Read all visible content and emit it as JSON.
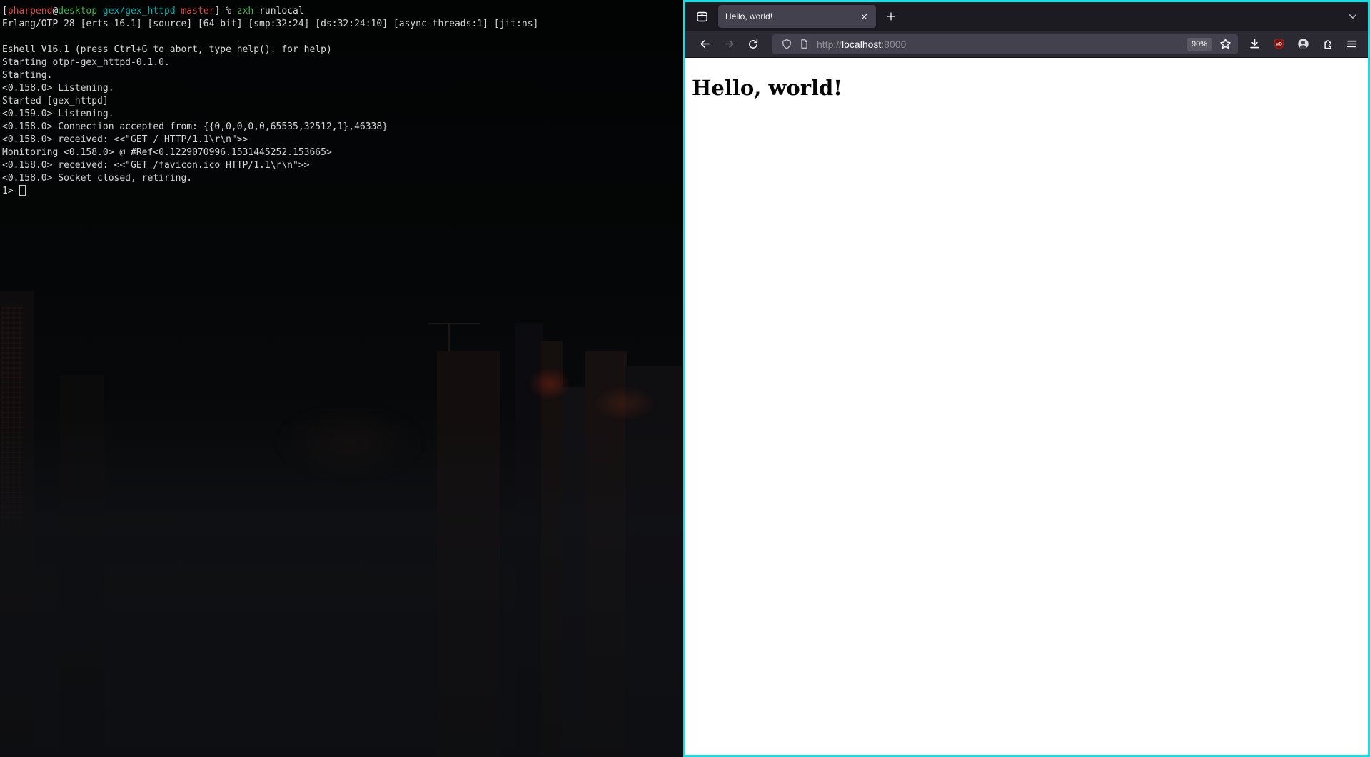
{
  "terminal": {
    "lines": [
      {
        "segments": [
          {
            "t": "[",
            "c": "fg"
          },
          {
            "t": "pharpend",
            "c": "red"
          },
          {
            "t": "@",
            "c": "fg"
          },
          {
            "t": "desktop",
            "c": "green"
          },
          {
            "t": " ",
            "c": "fg"
          },
          {
            "t": "gex/gex_httpd",
            "c": "cyan"
          },
          {
            "t": " ",
            "c": "fg"
          },
          {
            "t": "master",
            "c": "red"
          },
          {
            "t": "] % ",
            "c": "fg"
          },
          {
            "t": "zxh",
            "c": "green"
          },
          {
            "t": " runlocal",
            "c": "fg"
          }
        ]
      },
      {
        "text": "Erlang/OTP 28 [erts-16.1] [source] [64-bit] [smp:32:24] [ds:32:24:10] [async-threads:1] [jit:ns]"
      },
      {
        "text": ""
      },
      {
        "text": "Eshell V16.1 (press Ctrl+G to abort, type help(). for help)"
      },
      {
        "text": "Starting otpr-gex_httpd-0.1.0."
      },
      {
        "text": "Starting."
      },
      {
        "text": "<0.158.0> Listening."
      },
      {
        "text": "Started [gex_httpd]"
      },
      {
        "text": "<0.159.0> Listening."
      },
      {
        "text": "<0.158.0> Connection accepted from: {{0,0,0,0,0,65535,32512,1},46338}"
      },
      {
        "text": "<0.158.0> received: <<\"GET / HTTP/1.1\\r\\n\">>"
      },
      {
        "text": "Monitoring <0.158.0> @ #Ref<0.1229070996.1531445252.153665>"
      },
      {
        "text": "<0.158.0> received: <<\"GET /favicon.ico HTTP/1.1\\r\\n\">>"
      },
      {
        "text": "<0.158.0> Socket closed, retiring."
      },
      {
        "segments": [
          {
            "t": "1> ",
            "c": "fg"
          }
        ],
        "cursor": true
      }
    ],
    "palette": {
      "fg": "#d6d6d6",
      "red": "#dd4a44",
      "green": "#3eb349",
      "cyan": "#00b1b1"
    }
  },
  "browser": {
    "tab": {
      "title": "Hello, world!"
    },
    "urlbar": {
      "scheme": "http://",
      "host": "localhost",
      "port": ":8000"
    },
    "zoom_level": "90%",
    "page": {
      "heading": "Hello, world!"
    },
    "colors": {
      "window_border": "#17dde5",
      "tabbar_bg": "#1c1b22",
      "active_tab_bg": "#42414d",
      "toolbar_bg": "#2b2a33",
      "urlbar_bg": "#42414d",
      "page_bg": "#ffffff",
      "ublock_red": "#7c1210"
    },
    "icons": [
      "firefox-view-icon",
      "close-icon",
      "new-tab-icon",
      "list-all-tabs-icon",
      "back-icon",
      "forward-icon",
      "reload-icon",
      "shield-icon",
      "page-icon",
      "star-icon",
      "downloads-icon",
      "ublock-icon",
      "account-icon",
      "extensions-icon",
      "menu-icon"
    ]
  }
}
